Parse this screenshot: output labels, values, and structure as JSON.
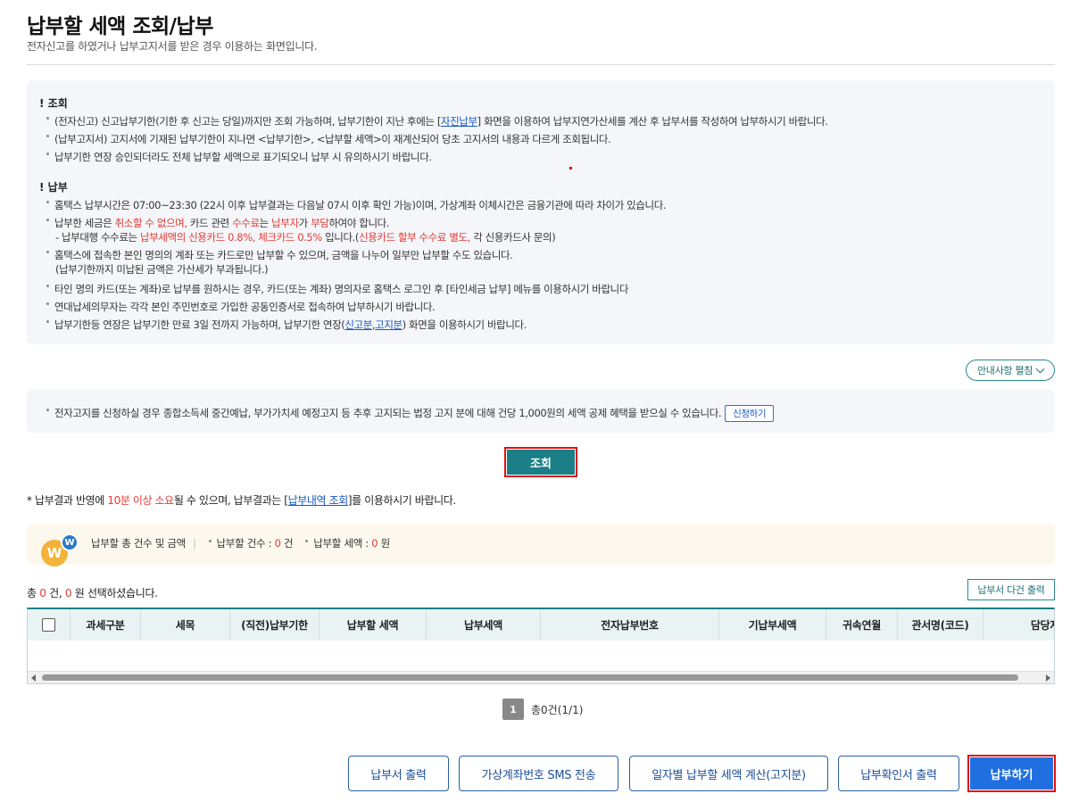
{
  "page": {
    "title": "납부할 세액 조회/납부",
    "subtitle": "전자신고를 하였거나 납부고지서를 받은 경우 이용하는 화면입니다."
  },
  "notice": {
    "inquiry_title": "! 조회",
    "inquiry": {
      "l1_a": "(전자신고) 신고납부기한(기한 후 신고는 당일)까지만 조회 가능하며, 납부기한이 지난 후에는 [",
      "l1_link": "자진납부",
      "l1_b": "] 화면을 이용하여 납부지연가산세를 계산 후 납부서를 작성하여 납부하시기 바랍니다.",
      "l2": "(납부고지서) 고지서에 기재된 납부기한이 지나면 <납부기한>, <납부할 세액>이 재계산되어 당초 고지서의 내용과 다르게 조회됩니다.",
      "l3": "납부기한 연장 승인되더라도 전체 납부할 세액으로 표기되오니 납부 시 유의하시기 바랍니다."
    },
    "payment_title": "! 납부",
    "payment": {
      "l1": "홈택스 납부시간은 07:00~23:30 (22시 이후 납부결과는 다음날 07시 이후 확인 가능)이며, 가상계좌 이체시간은 금융기관에 따라 차이가 있습니다.",
      "l2_a": "납부한 세금은 ",
      "l2_red1": "취소할 수 없으며,",
      "l2_b": " 카드 관련 ",
      "l2_red2": "수수료",
      "l2_c": "는 ",
      "l2_red3": "납부자",
      "l2_d": "가 ",
      "l2_red4": "부담",
      "l2_e": "하여야 합니다.",
      "l2s_a": "- 납부대행 수수료는 ",
      "l2s_red1": "납부세액의 신용카드 0.8%, 체크카드 0.5%",
      "l2s_b": " 입니다.(",
      "l2s_red2": "신용카드 할부 수수료 별도,",
      "l2s_c": " 각 신용카드사 문의)",
      "l3": "홈택스에 접속한 본인 명의의 계좌 또는 카드로만 납부할 수 있으며, 금액을 나누어 일부만 납부할 수도 있습니다.",
      "l3s": "(납부기한까지 미납된 금액은 가산세가 부과됩니다.)",
      "l4": "타인 명의 카드(또는 계좌)로 납부를 원하시는 경우, 카드(또는 계좌) 명의자로 홈택스 로그인 후 [타인세금 납부] 메뉴를 이용하시기 바랍니다",
      "l5": "연대납세의무자는 각각 본인 주민번호로 가입한 공동인증서로 접속하여 납부하시기 바랍니다.",
      "l6_a": "납부기한등 연장은 납부기한 만료 3일 전까지 가능하며, 납부기한 연장(",
      "l6_link1": "신고분",
      "l6_sep": ",",
      "l6_link2": "고지분",
      "l6_b": ") 화면을 이용하시기 바랍니다."
    }
  },
  "toggle_label": "안내사항 펼침",
  "etax": {
    "text": "전자고지를 신청하실 경우 종합소득세 중간예납, 부가가치세 예정고지 등 추후 고지되는 법정 고지 분에 대해 건당 1,000원의 세액 공제 혜택을 받으실 수 있습니다.",
    "button": "신청하기"
  },
  "search_button": "조회",
  "result_note": {
    "a": "* 납부결과 반영에 ",
    "red": "10분 이상 소요",
    "b": "될 수 있으며, 납부결과는 [",
    "link": "납부내역 조회",
    "c": "]를 이용하시기 바랍니다."
  },
  "summary": {
    "icon_big": "W",
    "icon_small": "W",
    "label": "납부할 총 건수 및 금액",
    "sep": "|",
    "count_label": "납부할 건수 : ",
    "count_value": "0",
    "count_unit": " 건",
    "amount_label": "납부할 세액 : ",
    "amount_value": "0",
    "amount_unit": " 원"
  },
  "total": {
    "a": "총 ",
    "count": "0",
    "b": " 건, ",
    "amount": "0",
    "c": " 원 선택하셨습니다."
  },
  "multi_print_button": "납부서 다건 출력",
  "table": {
    "headers": [
      "과세구분",
      "세목",
      "(직전)납부기한",
      "납부할 세액",
      "납부세액",
      "전자납부번호",
      "기납부세액",
      "귀속연월",
      "관서명(코드)",
      "담당자"
    ]
  },
  "pager": {
    "current": "1",
    "summary": "총0건(1/1)"
  },
  "bottom_buttons": {
    "print": "납부서 출력",
    "sms": "가상계좌번호 SMS 전송",
    "daily": "일자별 납부할 세액 계산(고지분)",
    "confirm": "납부확인서 출력",
    "pay": "납부하기"
  },
  "colors": {
    "accent_teal": "#1a7f86",
    "pay_blue": "#1f6fe0",
    "alert_red": "#e53935",
    "highlight_border": "#dd1111"
  }
}
